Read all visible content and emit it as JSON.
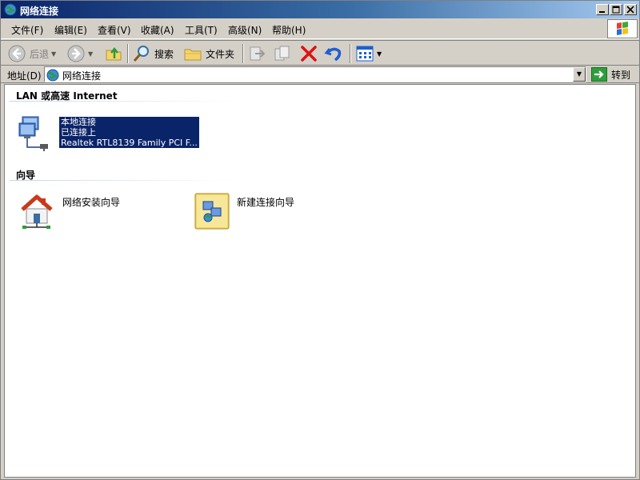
{
  "window": {
    "title": "网络连接"
  },
  "menu": {
    "items": [
      "文件(F)",
      "编辑(E)",
      "查看(V)",
      "收藏(A)",
      "工具(T)",
      "高级(N)",
      "帮助(H)"
    ]
  },
  "toolbar": {
    "back_label": "后退",
    "search_label": "搜索",
    "folders_label": "文件夹"
  },
  "address": {
    "label": "地址(D)",
    "value": "网络连接",
    "go_label": "转到"
  },
  "groups": {
    "lan": {
      "header": "LAN 或高速 Internet",
      "connection": {
        "name": "本地连接",
        "status": "已连接上",
        "device": "Realtek RTL8139 Family PCI F..."
      }
    },
    "wizard": {
      "header": "向导",
      "items": [
        "网络安装向导",
        "新建连接向导"
      ]
    }
  },
  "colors": {
    "selection": "#0a246a",
    "title_bar_start": "#0a246a",
    "title_bar_end": "#a6caf0",
    "delete_red": "#e01010"
  }
}
